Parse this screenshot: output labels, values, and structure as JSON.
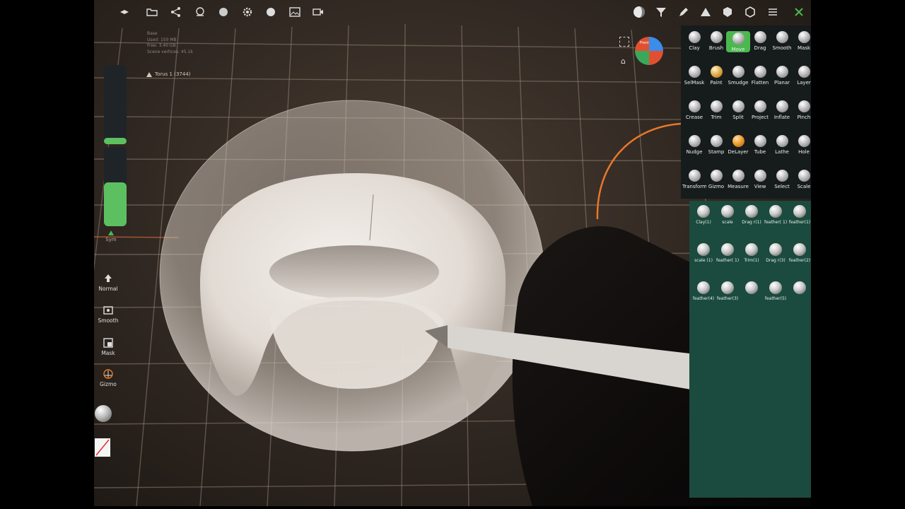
{
  "toolbar": {
    "icons": [
      "menu-icon",
      "folder-icon",
      "share-icon",
      "scene-icon",
      "material-icon",
      "settings-icon",
      "light-icon",
      "image-icon",
      "camera-icon",
      "matcap-icon",
      "filter-icon",
      "pen-icon",
      "warning-icon",
      "cube-icon",
      "hexagon-icon",
      "list-icon",
      "brush-settings-icon"
    ]
  },
  "stats": {
    "line1": "Base",
    "line2": "Used: 150 MB",
    "line3": "Free: 3.40 GB",
    "line4": "Scene vertices: 45.1k"
  },
  "mesh": {
    "name": "Torus 1 (3744)"
  },
  "left": {
    "sym_label": "Sym",
    "tools": [
      {
        "label": "Normal"
      },
      {
        "label": "Smooth"
      },
      {
        "label": "Mask"
      },
      {
        "label": "Gizmo"
      }
    ],
    "radius_level": 0.08,
    "intensity_level": 0.55
  },
  "palette": {
    "rows": [
      [
        "Clay",
        "Brush",
        "Move",
        "Drag",
        "Smooth",
        "Mask"
      ],
      [
        "SelMask",
        "Paint",
        "Smudge",
        "Flatten",
        "Planar",
        "Layer"
      ],
      [
        "Crease",
        "Trim",
        "Split",
        "Project",
        "Inflate",
        "Pinch"
      ],
      [
        "Nudge",
        "Stamp",
        "DeLayer",
        "Tube",
        "Lathe",
        "Hole"
      ],
      [
        "Transform",
        "Gizmo",
        "Measure",
        "View",
        "Select",
        "Scale"
      ]
    ],
    "active": "Move"
  },
  "presets": {
    "rows": [
      [
        "Clay(1)",
        "scale",
        "Drag r(1)",
        "feather( 1)",
        "feather(1)"
      ],
      [
        "scale (1)",
        "feather( 1)",
        "Trim(1)",
        "Drag r(3)",
        "feather(2)"
      ],
      [
        "feather(4)",
        "feather(3)",
        "",
        "feather(5)",
        ""
      ]
    ]
  },
  "orientation": {
    "label": "Front"
  },
  "colors": {
    "accent": "#4bb84f",
    "palette_bg": "#161b1c",
    "presets_bg": "#1b4a3e"
  }
}
